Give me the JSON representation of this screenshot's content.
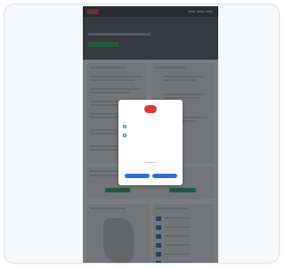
{
  "window": {
    "card_background": "#f6f8fb",
    "card_border": "#dbe2ec"
  },
  "site": {
    "logo_icon": "brand-logo-icon",
    "brand_color": "#d63a3a",
    "hero": {
      "title": "",
      "cta_color": "#1f9d55"
    }
  },
  "modal": {
    "logo_icon": "brand-logo-icon",
    "options": [
      {
        "icon": "radio-button-icon"
      },
      {
        "icon": "radio-button-icon"
      }
    ],
    "buttons": [
      {
        "color": "#2f6fd6"
      },
      {
        "color": "#2f6fd6"
      }
    ]
  },
  "overlay": {
    "color": "#2c3034"
  }
}
